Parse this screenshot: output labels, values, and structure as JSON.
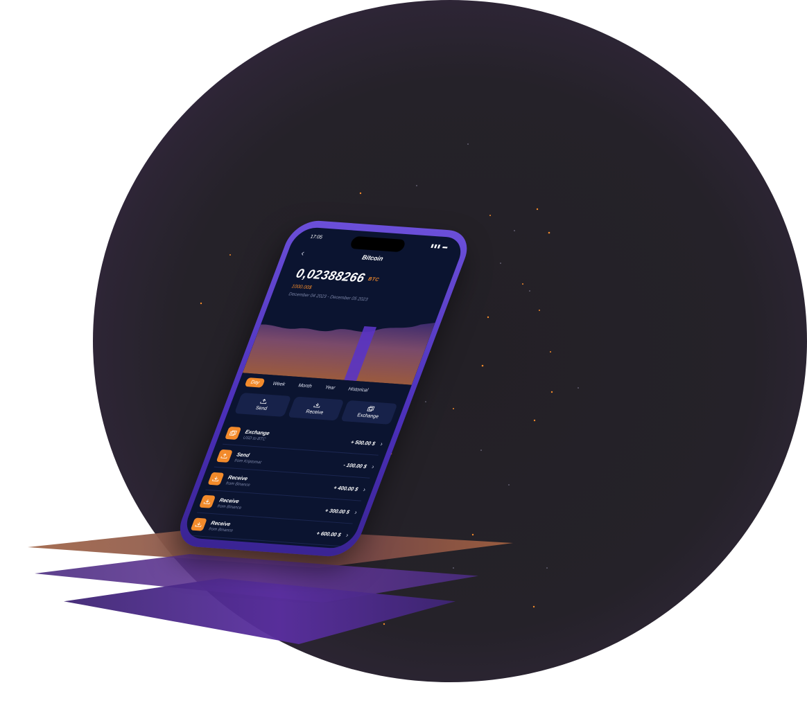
{
  "status": {
    "time": "17:05",
    "icons": "signal-battery"
  },
  "header": {
    "back_icon": "chevron-left-icon",
    "title": "Bitcoin"
  },
  "balance": {
    "amount": "0,02388266",
    "unit": "BTC",
    "fiat": "1000.00$",
    "date_range": "December 04 2023 - December 05 2023"
  },
  "tabs": [
    {
      "label": "Day",
      "active": true
    },
    {
      "label": "Week",
      "active": false
    },
    {
      "label": "Month",
      "active": false
    },
    {
      "label": "Year",
      "active": false
    },
    {
      "label": "Historical",
      "active": false
    }
  ],
  "actions": [
    {
      "label": "Send",
      "icon": "upload-icon"
    },
    {
      "label": "Receive",
      "icon": "download-icon"
    },
    {
      "label": "Exchange",
      "icon": "exchange-icon"
    }
  ],
  "transactions": [
    {
      "name": "Exchange",
      "sub": "USD to BTC",
      "amount": "+ 500.00 $",
      "icon": "exchange-icon"
    },
    {
      "name": "Send",
      "sub": "from Kriptomat",
      "amount": "- 100.00 $",
      "icon": "upload-icon"
    },
    {
      "name": "Receive",
      "sub": "from Binance",
      "amount": "+ 400.00 $",
      "icon": "download-icon"
    },
    {
      "name": "Receive",
      "sub": "from Binance",
      "amount": "+ 300.00 $",
      "icon": "download-icon"
    },
    {
      "name": "Receive",
      "sub": "from Binance",
      "amount": "+ 600.00 $",
      "icon": "download-icon"
    }
  ],
  "colors": {
    "accent": "#f28a2b",
    "screen_bg": "#0b1430",
    "frame": "#5b3fcf",
    "sphere_edge": "#4a2f72"
  }
}
